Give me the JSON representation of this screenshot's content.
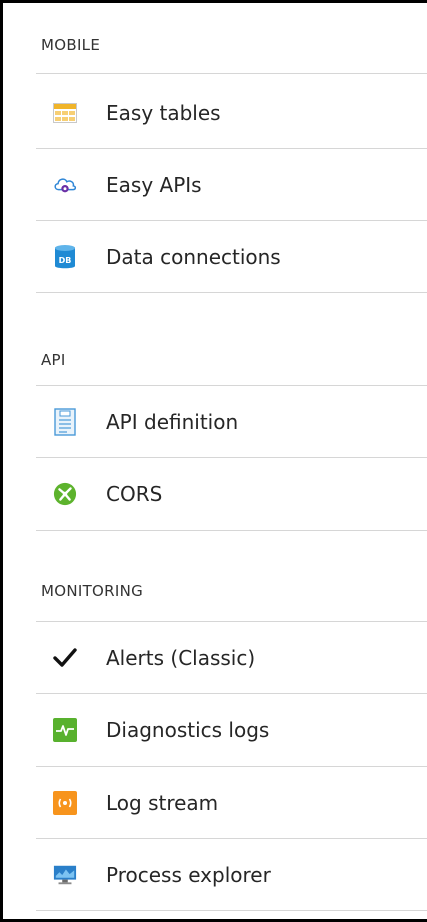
{
  "sections": [
    {
      "title": "MOBILE",
      "items": [
        {
          "label": "Easy tables",
          "icon": "table-icon"
        },
        {
          "label": "Easy APIs",
          "icon": "cloud-api-icon"
        },
        {
          "label": "Data connections",
          "icon": "database-icon"
        }
      ]
    },
    {
      "title": "API",
      "items": [
        {
          "label": "API definition",
          "icon": "document-icon"
        },
        {
          "label": "CORS",
          "icon": "cors-icon"
        }
      ]
    },
    {
      "title": "MONITORING",
      "items": [
        {
          "label": "Alerts (Classic)",
          "icon": "checkmark-icon"
        },
        {
          "label": "Diagnostics logs",
          "icon": "pulse-icon"
        },
        {
          "label": "Log stream",
          "icon": "stream-icon"
        },
        {
          "label": "Process explorer",
          "icon": "monitor-icon"
        }
      ]
    }
  ],
  "icon_badges": {
    "database": "DB"
  },
  "colors": {
    "table_icon": "#f0b429",
    "cloud_icon": "#2f86d6",
    "database_icon": "#1f8ad4",
    "cors_icon": "#5db32d",
    "pulse_icon": "#58b12e",
    "stream_icon": "#f7941d",
    "monitor_icon": "#2a7fc9",
    "divider": "#d6d6d6"
  }
}
